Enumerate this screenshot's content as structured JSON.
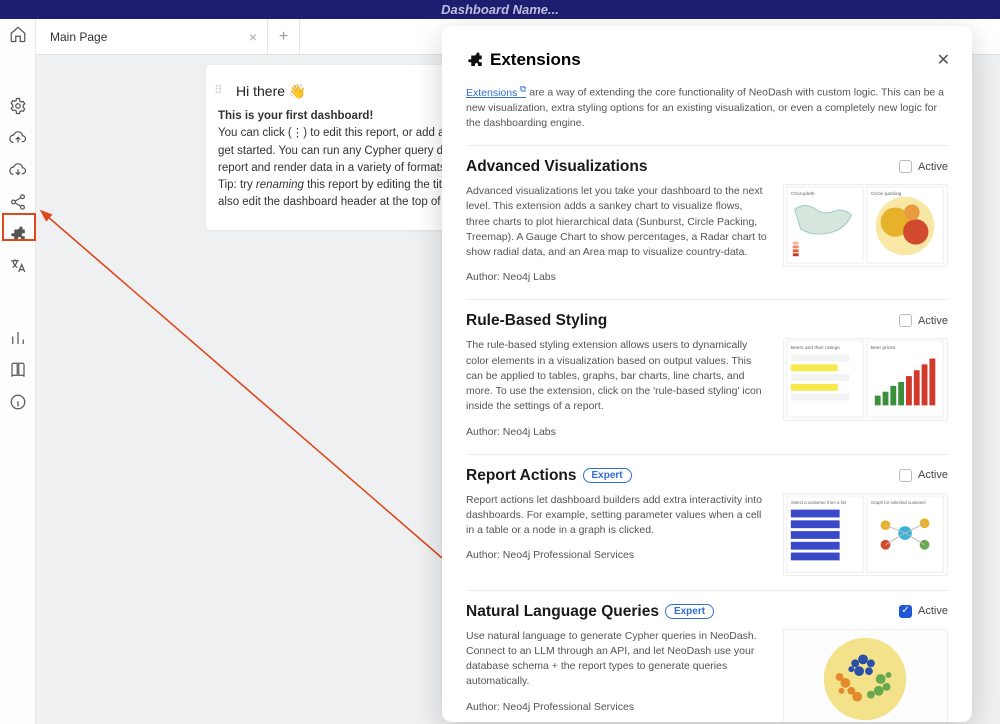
{
  "header": {
    "title": "Dashboard Name..."
  },
  "tabs": {
    "main": "Main Page"
  },
  "panel": {
    "title": "Hi there 👋",
    "line1": "This is your first dashboard!",
    "line2a": "You can click (⋮) to edit this report, or add a new report to ",
    "line2b": "get started. You can run any Cypher query directly from e",
    "line2c": "report and render data in a variety of formats.",
    "line3a": "Tip: try ",
    "line3em": "renaming",
    "line3b": " this report by editing the title text. You c",
    "line3c": "also edit the dashboard header at the top of the screen."
  },
  "modal": {
    "title": "Extensions",
    "intro_link": "Extensions",
    "intro_text": " are a way of extending the core functionality of NeoDash with custom logic. This can be a new visualization, extra styling options for an existing visualization, or even a completely new logic for the dashboarding engine.",
    "active_label": "Active",
    "sections": {
      "adv": {
        "title": "Advanced Visualizations",
        "desc": "Advanced visualizations let you take your dashboard to the next level. This extension adds a sankey chart to visualize flows, three charts to plot hierarchical data (Sunburst, Circle Packing, Treemap). A Gauge Chart to show percentages, a Radar chart to show radial data, and an Area map to visualize country-data.",
        "author": "Author: Neo4j Labs"
      },
      "rbs": {
        "title": "Rule-Based Styling",
        "desc": "The rule-based styling extension allows users to dynamically color elements in a visualization based on output values. This can be applied to tables, graphs, bar charts, line charts, and more. To use the extension, click on the 'rule-based styling' icon inside the settings of a report.",
        "author": "Author: Neo4j Labs"
      },
      "ra": {
        "title": "Report Actions",
        "badge": "Expert",
        "desc": "Report actions let dashboard builders add extra interactivity into dashboards. For example, setting parameter values when a cell in a table or a node in a graph is clicked.",
        "author": "Author: Neo4j Professional Services"
      },
      "nlq": {
        "title": "Natural Language Queries",
        "badge": "Expert",
        "desc": "Use natural language to generate Cypher queries in NeoDash. Connect to an LLM through an API, and let NeoDash use your database schema + the report types to generate queries automatically.",
        "author": "Author: Neo4j Professional Services"
      }
    }
  }
}
